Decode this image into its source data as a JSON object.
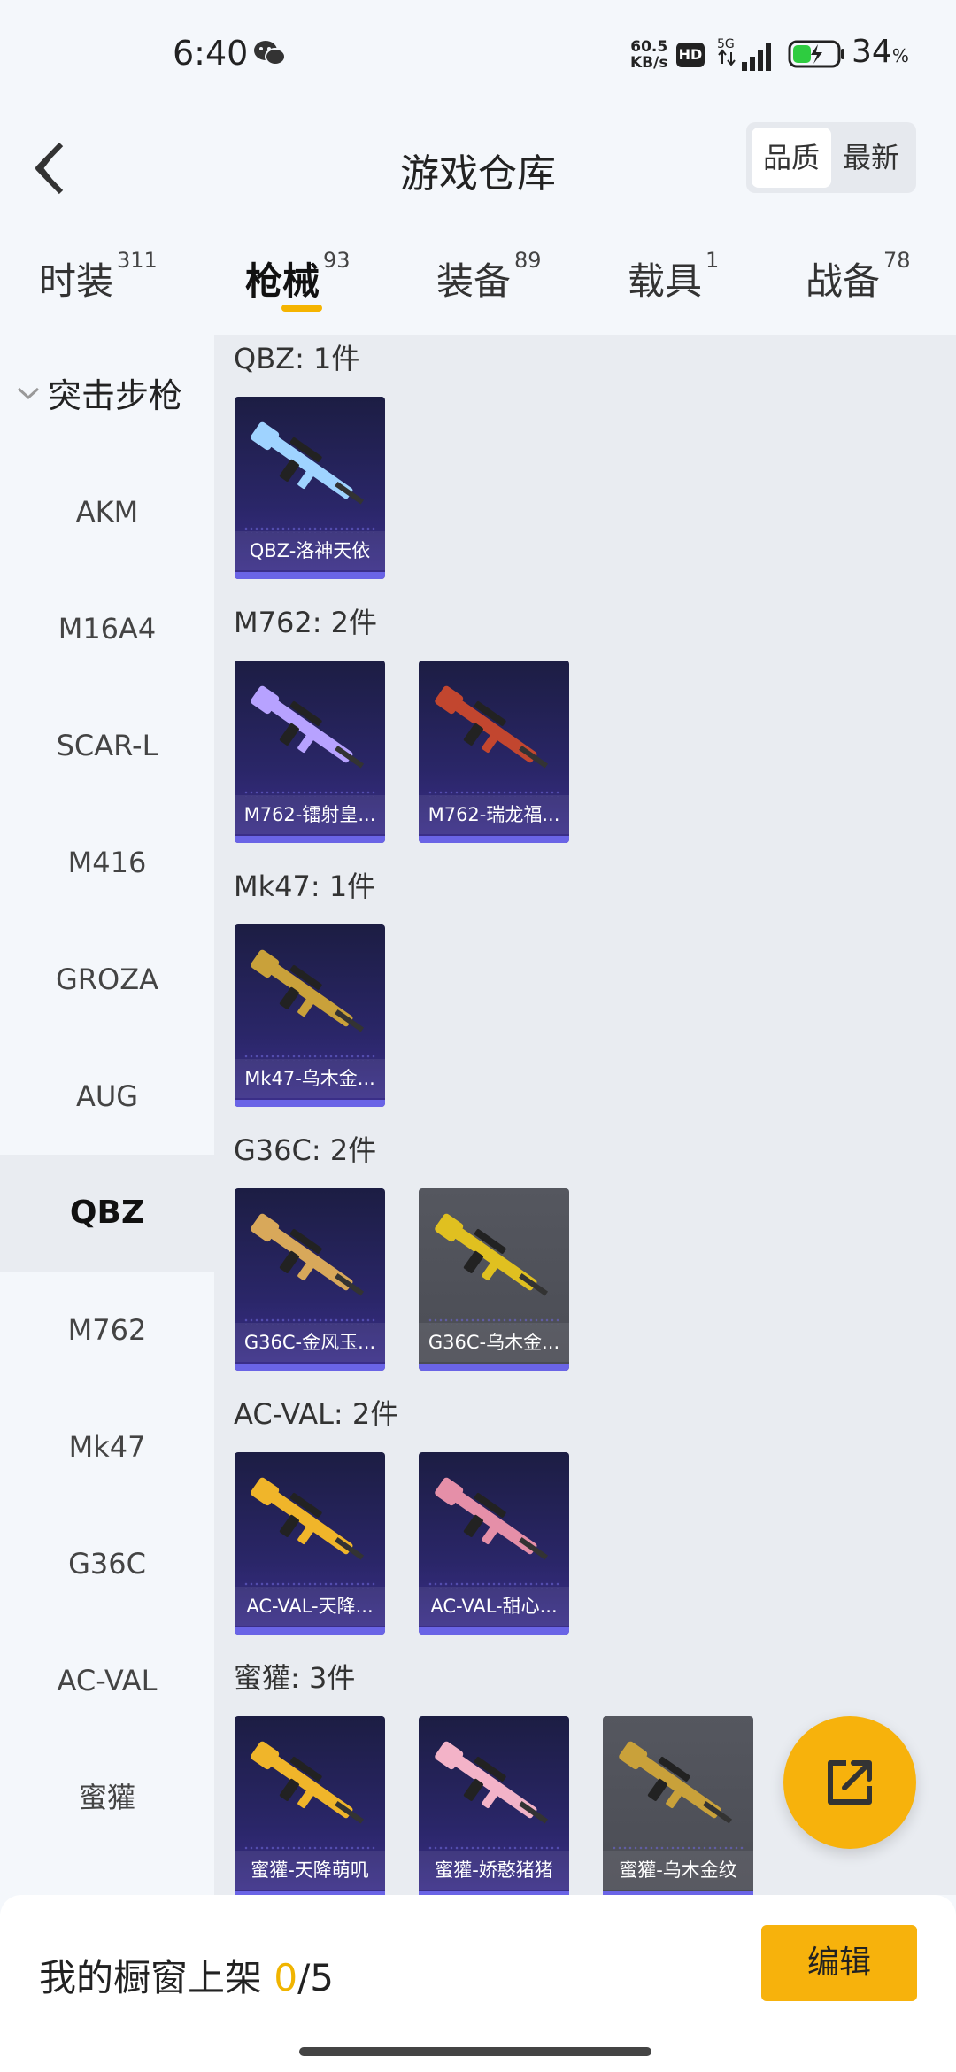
{
  "status_bar": {
    "time": "6:40",
    "net_speed_value": "60.5",
    "net_speed_unit": "KB/s",
    "hd_label": "HD",
    "signal_label": "5G",
    "battery_percent": "34",
    "battery_unit": "%"
  },
  "header": {
    "title": "游戏仓库",
    "sort_options": [
      "品质",
      "最新"
    ],
    "sort_selected": "品质"
  },
  "tabs": [
    {
      "label": "时装",
      "count": "311"
    },
    {
      "label": "枪械",
      "count": "93",
      "active": true
    },
    {
      "label": "装备",
      "count": "89"
    },
    {
      "label": "载具",
      "count": "1"
    },
    {
      "label": "战备",
      "count": "78"
    }
  ],
  "sidebar": {
    "heading": "突击步枪",
    "items": [
      "AKM",
      "M16A4",
      "SCAR-L",
      "M416",
      "GROZA",
      "AUG",
      "QBZ",
      "M762",
      "Mk47",
      "G36C",
      "AC-VAL",
      "蜜獾"
    ],
    "selected": "QBZ"
  },
  "groups": [
    {
      "title": "QBZ: 1件",
      "items": [
        {
          "name": "QBZ-洛神天依",
          "style": "purple",
          "gun_color": "#9fd3ff"
        }
      ]
    },
    {
      "title": "M762: 2件",
      "items": [
        {
          "name": "M762-镭射皇...",
          "style": "purple",
          "gun_color": "#b7a2ff"
        },
        {
          "name": "M762-瑞龙福...",
          "style": "purple",
          "gun_color": "#c2462f"
        }
      ]
    },
    {
      "title": "Mk47: 1件",
      "items": [
        {
          "name": "Mk47-乌木金...",
          "style": "purple",
          "gun_color": "#c9a13a"
        }
      ]
    },
    {
      "title": "G36C: 2件",
      "items": [
        {
          "name": "G36C-金风玉...",
          "style": "purple",
          "gun_color": "#d8a85a"
        },
        {
          "name": "G36C-乌木金...",
          "style": "gray",
          "gun_color": "#e0c020"
        }
      ]
    },
    {
      "title": "AC-VAL: 2件",
      "items": [
        {
          "name": "AC-VAL-天降...",
          "style": "purple",
          "gun_color": "#f0b52a"
        },
        {
          "name": "AC-VAL-甜心...",
          "style": "purple",
          "gun_color": "#e58fa8"
        }
      ]
    },
    {
      "title": "蜜獾: 3件",
      "items": [
        {
          "name": "蜜獾-天降萌叽",
          "style": "purple",
          "gun_color": "#f0b52a"
        },
        {
          "name": "蜜獾-娇憨猪猪",
          "style": "purple",
          "gun_color": "#f3b3c8"
        },
        {
          "name": "蜜獾-乌木金纹",
          "style": "gray",
          "gun_color": "#c9a13a"
        }
      ]
    }
  ],
  "bottom_bar": {
    "shelf_label": "我的橱窗上架",
    "shelf_count": "0",
    "shelf_sep_total": "/5",
    "edit_label": "编辑"
  },
  "colors": {
    "accent": "#f7b20c",
    "card_purple": "#2a2668",
    "card_gray": "#4f5159",
    "background": "#f4f7fb"
  }
}
